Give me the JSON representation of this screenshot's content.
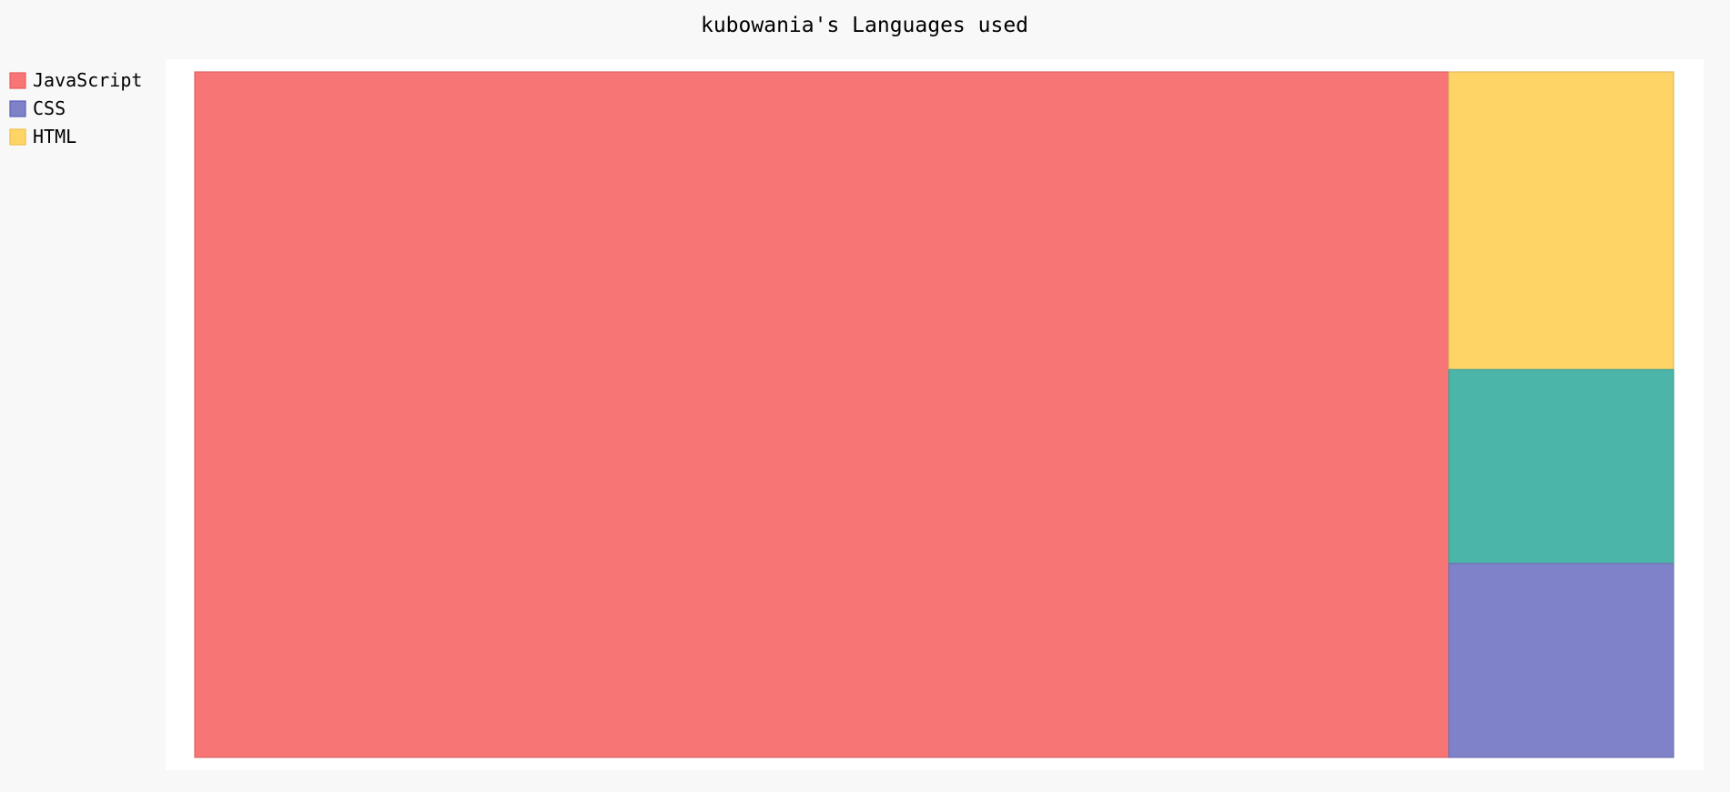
{
  "chart_data": {
    "type": "treemap",
    "title": "kubowania's Languages used",
    "legend": {
      "position": "left",
      "entries": [
        {
          "name": "JavaScript",
          "color": "#f87575"
        },
        {
          "name": "CSS",
          "color": "#7f82c9"
        },
        {
          "name": "HTML",
          "color": "#fed467"
        }
      ]
    },
    "items": [
      {
        "color": "#f87575",
        "value": 84.8
      },
      {
        "color": "#fed467",
        "value": 6.6
      },
      {
        "color": "#4cb5a9",
        "value": 4.3
      },
      {
        "color": "#7f82c9",
        "value": 4.3
      }
    ]
  }
}
